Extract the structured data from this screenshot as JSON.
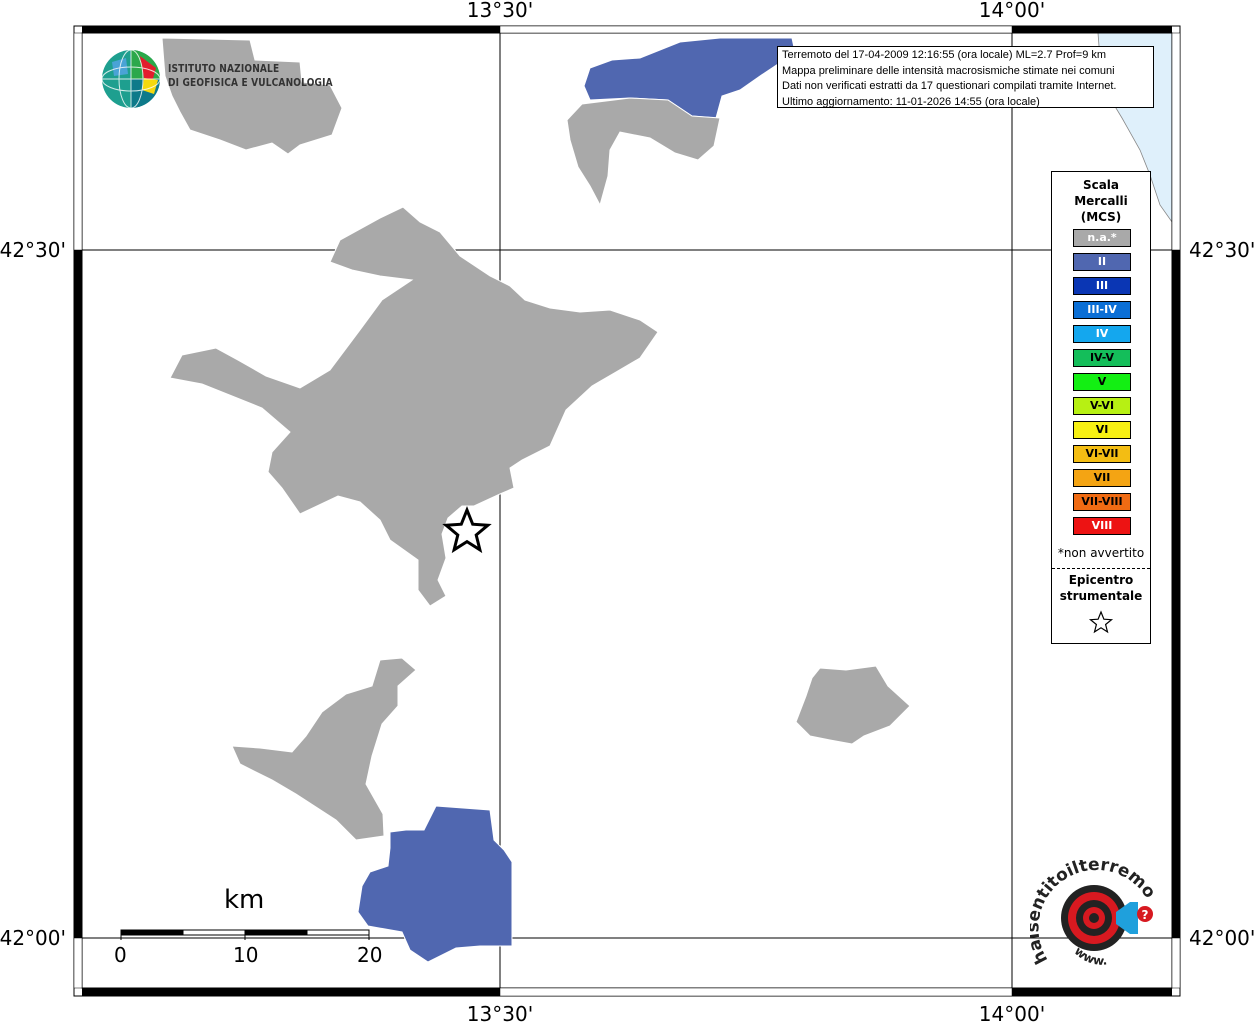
{
  "map": {
    "lon_top": [
      "13°30'",
      "14°00'"
    ],
    "lon_bottom": [
      "13°30'",
      "14°00'"
    ],
    "lat_left": [
      "42°30'",
      "42°00'"
    ],
    "lat_right": [
      "42°30'",
      "42°00'"
    ]
  },
  "info": {
    "line1": "Terremoto del 17-04-2009 12:16:55 (ora locale) ML=2.7 Prof=9 km",
    "line2": "Mappa preliminare delle intensità macrosismiche stimate nei comuni",
    "line3": "Dati non verificati estratti da 17 questionari compilati tramite Internet.",
    "line4": "Ultimo aggiornamento: 11-01-2026 14:55 (ora locale)"
  },
  "logo_ingv": {
    "line1": "ISTITUTO NAZIONALE",
    "line2": "DI GEOFISICA E VULCANOLOGIA"
  },
  "legend": {
    "title1": "Scala",
    "title2": "Mercalli",
    "title3": "(MCS)",
    "items": [
      {
        "label": "n.a.*",
        "color": "#a9a9a9",
        "text_color": "#ffffff"
      },
      {
        "label": "II",
        "color": "#5067b0",
        "text_color": "#ffffff"
      },
      {
        "label": "III",
        "color": "#0a36b4",
        "text_color": "#ffffff"
      },
      {
        "label": "III-IV",
        "color": "#0b6fd6",
        "text_color": "#ffffff"
      },
      {
        "label": "IV",
        "color": "#14a7ee",
        "text_color": "#ffffff"
      },
      {
        "label": "IV-V",
        "color": "#14be5a",
        "text_color": "#000000"
      },
      {
        "label": "V",
        "color": "#13ef13",
        "text_color": "#000000"
      },
      {
        "label": "V-VI",
        "color": "#b7f013",
        "text_color": "#000000"
      },
      {
        "label": "VI",
        "color": "#f7f013",
        "text_color": "#000000"
      },
      {
        "label": "VI-VII",
        "color": "#f3bd13",
        "text_color": "#000000"
      },
      {
        "label": "VII",
        "color": "#f4a413",
        "text_color": "#000000"
      },
      {
        "label": "VII-VIII",
        "color": "#f06b13",
        "text_color": "#000000"
      },
      {
        "label": "VIII",
        "color": "#ed1313",
        "text_color": "#ffffff"
      }
    ],
    "note": "*non avvertito",
    "epicentre1": "Epicentro",
    "epicentre2": "strumentale"
  },
  "scale": {
    "unit": "km",
    "ticks": [
      "0",
      "10",
      "20"
    ]
  },
  "logo_hsit": {
    "text": "haisentitoilterremoto.it",
    "www": "www."
  },
  "colors": {
    "na": "#a9a9a9",
    "ii": "#5067b0",
    "sea": "#dff0fb"
  }
}
